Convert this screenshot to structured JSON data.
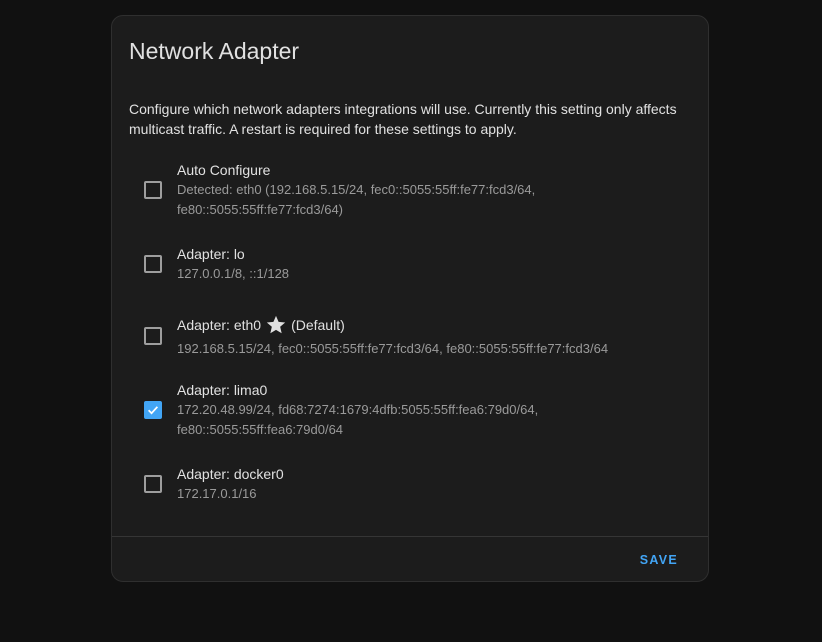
{
  "card": {
    "title": "Network Adapter",
    "description": "Configure which network adapters integrations will use. Currently this setting only affects multicast traffic. A restart is required for these settings to apply."
  },
  "options": [
    {
      "label": "Auto Configure",
      "detail_lines": [
        "Detected: eth0 (192.168.5.15/24, fec0::5055:55ff:fe77:fcd3/64,",
        "fe80::5055:55ff:fe77:fcd3/64)"
      ],
      "checked": false
    },
    {
      "label": "Adapter: lo",
      "detail_lines": [
        "127.0.0.1/8, ::1/128"
      ],
      "checked": false
    },
    {
      "label": "Adapter: eth0",
      "suffix_icon": "star-icon",
      "suffix": "(Default)",
      "detail_lines": [
        "192.168.5.15/24, fec0::5055:55ff:fe77:fcd3/64, fe80::5055:55ff:fe77:fcd3/64"
      ],
      "checked": false
    },
    {
      "label": "Adapter: lima0",
      "detail_lines": [
        "172.20.48.99/24, fd68:7274:1679:4dfb:5055:55ff:fea6:79d0/64,",
        "fe80::5055:55ff:fea6:79d0/64"
      ],
      "checked": true
    },
    {
      "label": "Adapter: docker0",
      "detail_lines": [
        "172.17.0.1/16"
      ],
      "checked": false
    }
  ],
  "actions": {
    "save_label": "SAVE"
  },
  "colors": {
    "accent": "#42a5f5",
    "card_background": "#1c1c1c",
    "page_background": "#111111",
    "secondary_text": "#9a9a9a"
  }
}
